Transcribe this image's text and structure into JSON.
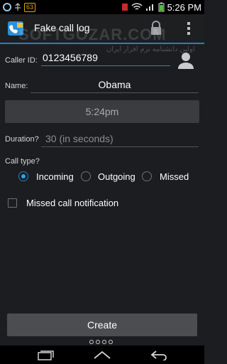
{
  "statusbar": {
    "badge": "63",
    "time": "5:26 PM"
  },
  "actionbar": {
    "title": "Fake call log",
    "watermark": "SOFTGOZAR.COM",
    "watermark_sub": "اولین دانشنامه نرم افزار ایران"
  },
  "form": {
    "caller_id_label": "Caller ID:",
    "caller_id_value": "0123456789",
    "name_label": "Name:",
    "name_value": "Obama",
    "time_value": "5:24pm",
    "duration_label": "Duration?",
    "duration_placeholder": "30 (in seconds)",
    "call_type_label": "Call type?",
    "call_types": [
      {
        "label": "Incoming",
        "selected": true
      },
      {
        "label": "Outgoing",
        "selected": false
      },
      {
        "label": "Missed",
        "selected": false
      }
    ],
    "missed_notification_label": "Missed call notification",
    "missed_notification_checked": false,
    "create_label": "Create"
  },
  "icons": [
    "app-icon",
    "lock-icon",
    "overflow-menu-icon",
    "contact-person-icon",
    "back-icon",
    "home-icon",
    "recent-apps-icon"
  ],
  "colors": {
    "accent": "#2b7fb8",
    "background": "#1b1d20"
  }
}
